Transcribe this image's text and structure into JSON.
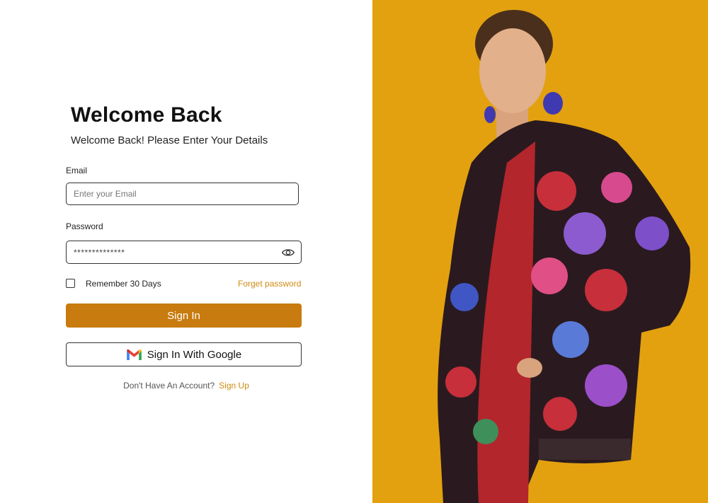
{
  "login": {
    "title": "Welcome Back",
    "subtitle": "Welcome Back! Please Enter Your Details",
    "email_label": "Email",
    "email_placeholder": "Enter your Email",
    "email_value": "",
    "password_label": "Password",
    "password_value": "**************",
    "remember_label": "Remember 30 Days",
    "remember_checked": false,
    "forgot_label": "Forget password",
    "signin_label": "Sign In",
    "google_label": "Sign In With Google",
    "no_account_text": "Don't Have An Account?",
    "signup_label": "Sign Up"
  },
  "theme": {
    "accent": "#c87b0e",
    "link": "#d08a12",
    "hero_background": "#e3a10f"
  },
  "icons": {
    "password_toggle": "eye-icon",
    "google": "gmail-icon"
  }
}
